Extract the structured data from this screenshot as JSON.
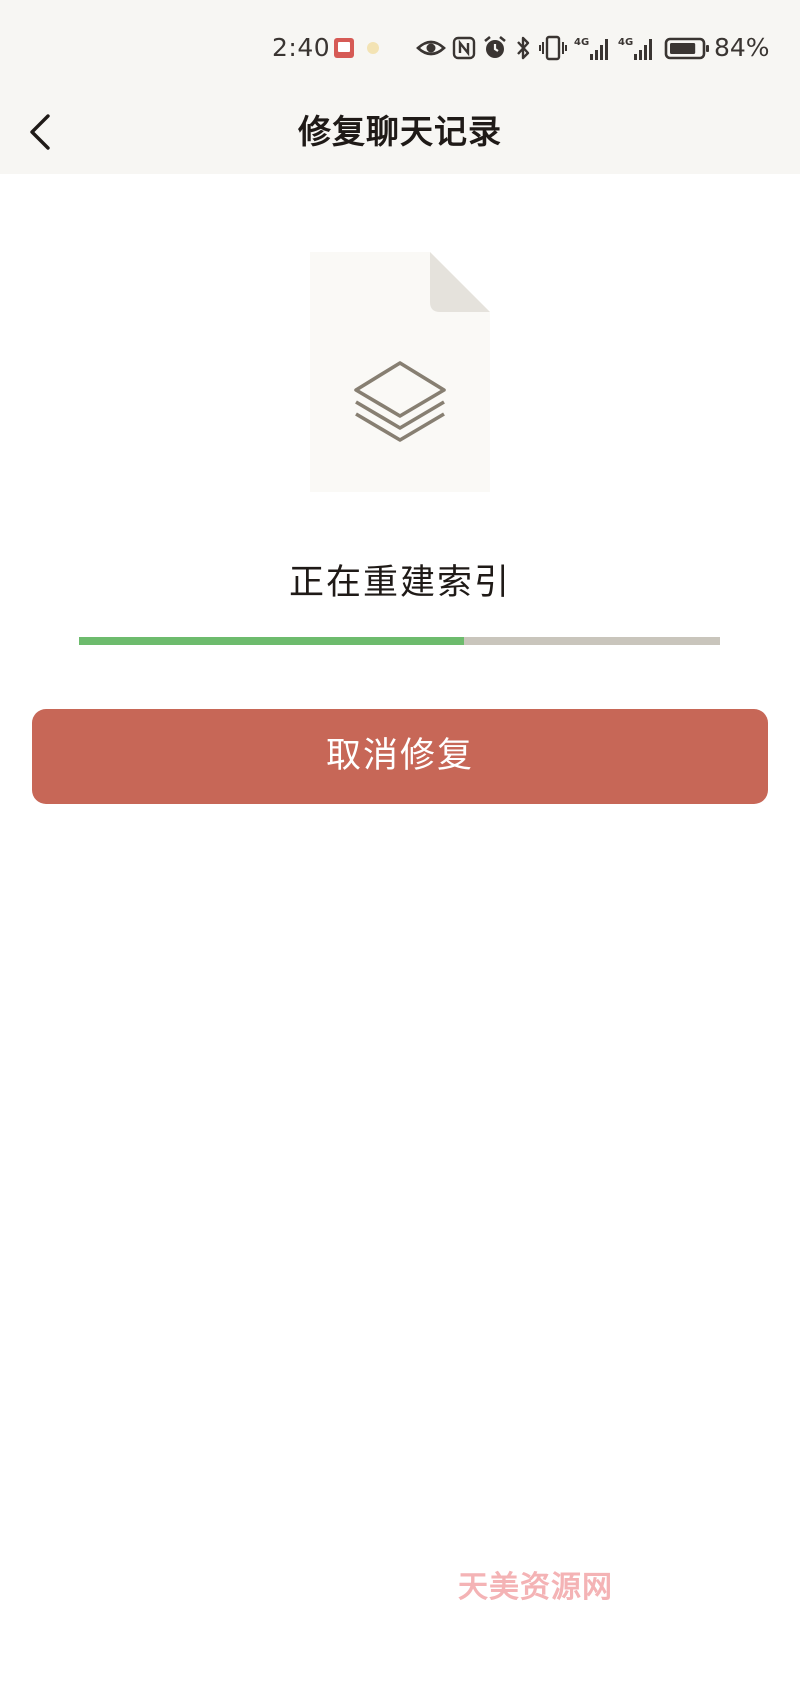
{
  "status_bar": {
    "time": "2:40",
    "battery_percent": "84%",
    "battery_level": 0.84,
    "icons": [
      "notification-app-icon",
      "weather-icon",
      "eye-comfort-icon",
      "nfc-icon",
      "alarm-icon",
      "bluetooth-icon",
      "vibrate-icon",
      "signal-4g-icon",
      "signal-4g-icon",
      "battery-icon"
    ]
  },
  "nav": {
    "back_icon": "chevron-left-icon",
    "title": "修复聊天记录"
  },
  "illustration": {
    "icon": "layers-icon"
  },
  "progress": {
    "label": "正在重建索引",
    "value": 0.6
  },
  "cancel_button": {
    "label": "取消修复"
  },
  "watermark": {
    "text": "天美资源网"
  },
  "colors": {
    "accent_red": "#c76757",
    "progress_green": "#6dbb6d",
    "progress_track": "#c9c5bc",
    "header_bg": "#f7f6f3"
  }
}
